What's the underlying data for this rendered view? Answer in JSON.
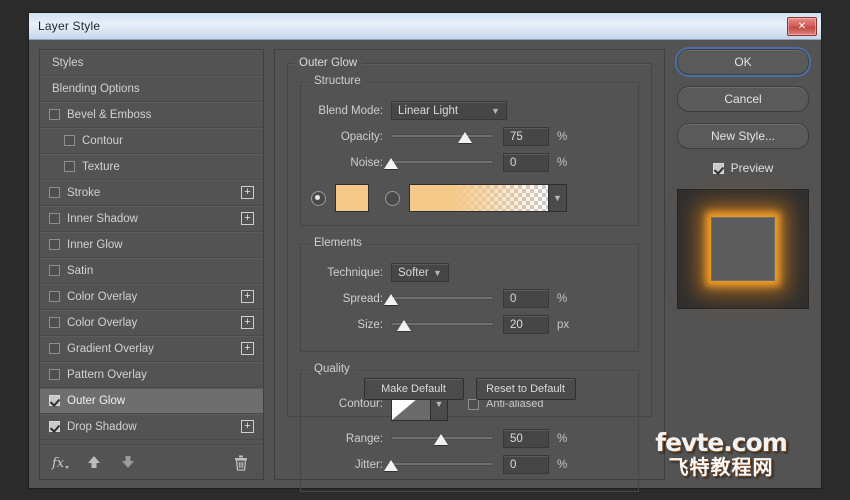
{
  "window": {
    "title": "Layer Style",
    "close_label": "✕"
  },
  "styles_panel": {
    "items": [
      {
        "label": "Styles",
        "type": "plain",
        "checked": null,
        "plus": false,
        "indent": false,
        "selected": false
      },
      {
        "label": "Blending Options",
        "type": "plain",
        "checked": null,
        "plus": false,
        "indent": false,
        "selected": false
      },
      {
        "label": "Bevel & Emboss",
        "type": "check",
        "checked": false,
        "plus": false,
        "indent": false,
        "selected": false
      },
      {
        "label": "Contour",
        "type": "check",
        "checked": false,
        "plus": false,
        "indent": true,
        "selected": false
      },
      {
        "label": "Texture",
        "type": "check",
        "checked": false,
        "plus": false,
        "indent": true,
        "selected": false
      },
      {
        "label": "Stroke",
        "type": "check",
        "checked": false,
        "plus": true,
        "indent": false,
        "selected": false
      },
      {
        "label": "Inner Shadow",
        "type": "check",
        "checked": false,
        "plus": true,
        "indent": false,
        "selected": false
      },
      {
        "label": "Inner Glow",
        "type": "check",
        "checked": false,
        "plus": false,
        "indent": false,
        "selected": false
      },
      {
        "label": "Satin",
        "type": "check",
        "checked": false,
        "plus": false,
        "indent": false,
        "selected": false
      },
      {
        "label": "Color Overlay",
        "type": "check",
        "checked": false,
        "plus": true,
        "indent": false,
        "selected": false
      },
      {
        "label": "Color Overlay",
        "type": "check",
        "checked": false,
        "plus": true,
        "indent": false,
        "selected": false
      },
      {
        "label": "Gradient Overlay",
        "type": "check",
        "checked": false,
        "plus": true,
        "indent": false,
        "selected": false
      },
      {
        "label": "Pattern Overlay",
        "type": "check",
        "checked": false,
        "plus": false,
        "indent": false,
        "selected": false
      },
      {
        "label": "Outer Glow",
        "type": "check",
        "checked": true,
        "plus": false,
        "indent": false,
        "selected": true
      },
      {
        "label": "Drop Shadow",
        "type": "check",
        "checked": true,
        "plus": true,
        "indent": false,
        "selected": false
      }
    ],
    "toolbar": {
      "fx": "fx",
      "move_up": "▲",
      "move_down": "▼",
      "delete": "🗑"
    }
  },
  "settings": {
    "panel_title": "Outer Glow",
    "structure": {
      "caption": "Structure",
      "blend_mode_label": "Blend Mode:",
      "blend_mode_value": "Linear Light",
      "opacity_label": "Opacity:",
      "opacity_value": "75",
      "opacity_unit": "%",
      "opacity_pct": 72,
      "noise_label": "Noise:",
      "noise_value": "0",
      "noise_unit": "%",
      "noise_pct": 0,
      "fill_mode": "color",
      "color_hex": "#f5c98a",
      "gradient_from": "#f5c98a",
      "gradient_to": "transparent"
    },
    "elements": {
      "caption": "Elements",
      "technique_label": "Technique:",
      "technique_value": "Softer",
      "spread_label": "Spread:",
      "spread_value": "0",
      "spread_unit": "%",
      "spread_pct": 0,
      "size_label": "Size:",
      "size_value": "20",
      "size_unit": "px",
      "size_pct": 13
    },
    "quality": {
      "caption": "Quality",
      "contour_label": "Contour:",
      "anti_aliased_label": "Anti-aliased",
      "anti_aliased_checked": false,
      "range_label": "Range:",
      "range_value": "50",
      "range_unit": "%",
      "range_pct": 49,
      "jitter_label": "Jitter:",
      "jitter_value": "0",
      "jitter_unit": "%",
      "jitter_pct": 0
    },
    "make_default_label": "Make Default",
    "reset_default_label": "Reset to Default"
  },
  "actions": {
    "ok_label": "OK",
    "cancel_label": "Cancel",
    "new_style_label": "New Style...",
    "preview_label": "Preview",
    "preview_checked": true
  },
  "watermark": {
    "line1": "fevte.com",
    "line2": "飞特教程网"
  }
}
